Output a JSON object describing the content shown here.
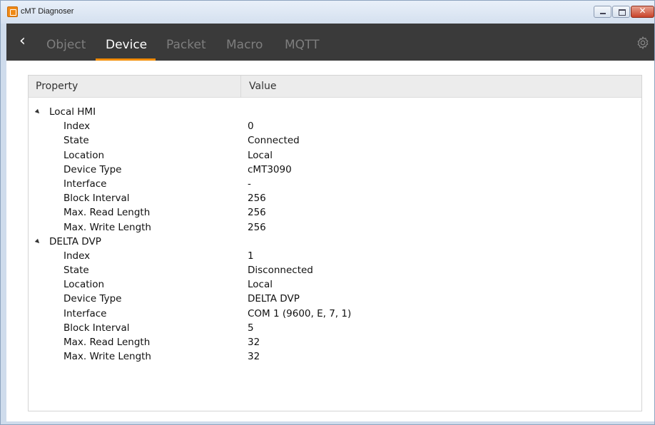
{
  "window": {
    "title": "cMT Diagnoser",
    "close_glyph": "✕"
  },
  "nav": {
    "back_glyph": "‹",
    "tabs": [
      {
        "label": "Object"
      },
      {
        "label": "Device"
      },
      {
        "label": "Packet"
      },
      {
        "label": "Macro"
      },
      {
        "label": "MQTT"
      }
    ],
    "active_tab": "Device",
    "accent_color": "#f28c00"
  },
  "table": {
    "headers": {
      "property": "Property",
      "value": "Value"
    },
    "groups": [
      {
        "name": "Local HMI",
        "rows": [
          {
            "property": "Index",
            "value": "0"
          },
          {
            "property": "State",
            "value": "Connected"
          },
          {
            "property": "Location",
            "value": "Local"
          },
          {
            "property": "Device Type",
            "value": "cMT3090"
          },
          {
            "property": "Interface",
            "value": "-"
          },
          {
            "property": "Block Interval",
            "value": "256"
          },
          {
            "property": "Max. Read Length",
            "value": "256"
          },
          {
            "property": "Max. Write Length",
            "value": "256"
          }
        ]
      },
      {
        "name": "DELTA DVP",
        "rows": [
          {
            "property": "Index",
            "value": "1"
          },
          {
            "property": "State",
            "value": "Disconnected"
          },
          {
            "property": "Location",
            "value": "Local"
          },
          {
            "property": "Device Type",
            "value": "DELTA DVP"
          },
          {
            "property": "Interface",
            "value": "COM 1 (9600, E, 7, 1)"
          },
          {
            "property": "Block Interval",
            "value": "5"
          },
          {
            "property": "Max. Read Length",
            "value": "32"
          },
          {
            "property": "Max. Write Length",
            "value": "32"
          }
        ]
      }
    ]
  }
}
